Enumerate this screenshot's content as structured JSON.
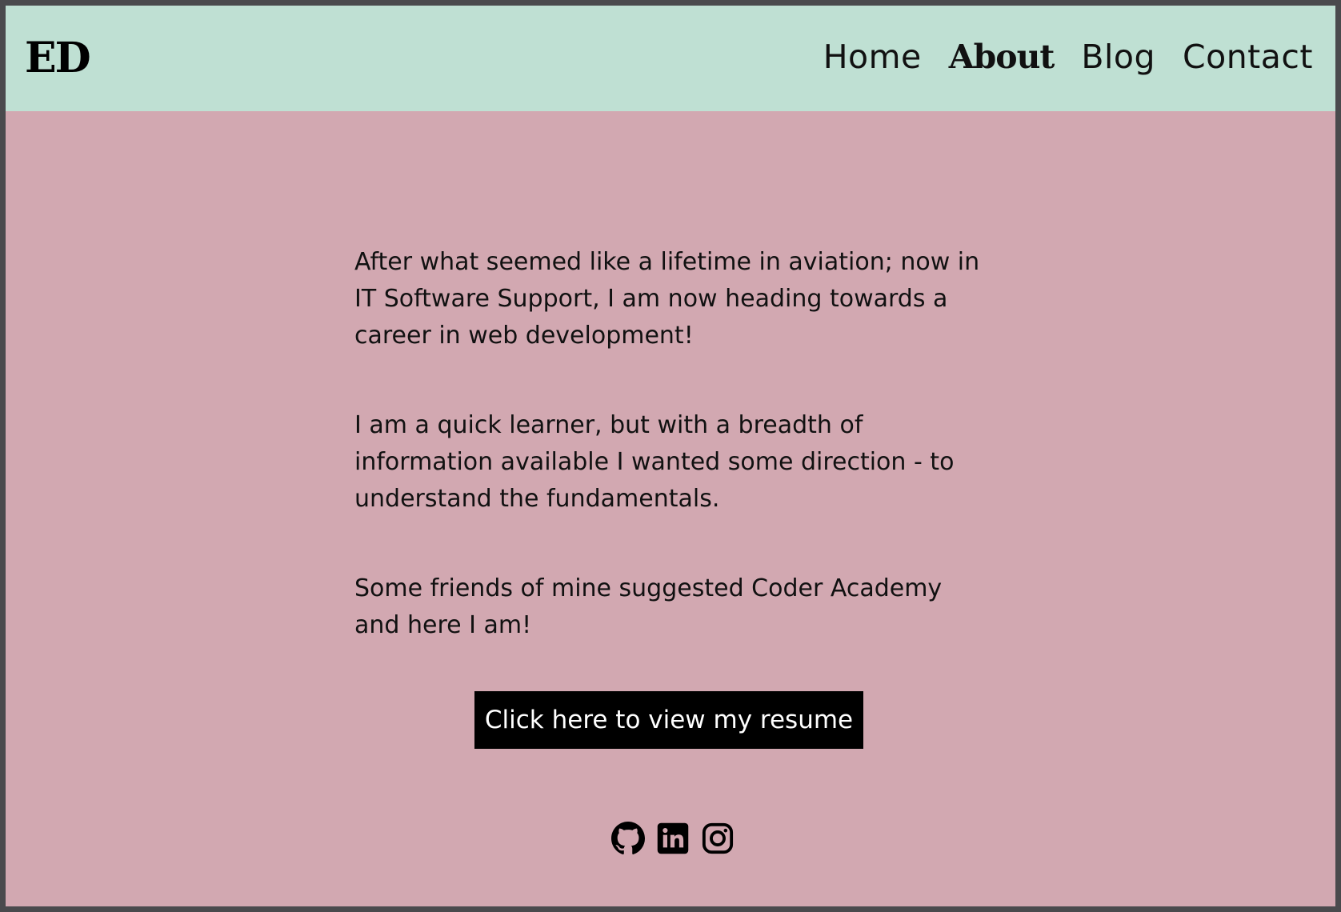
{
  "header": {
    "logo": "ED",
    "nav": [
      {
        "label": "Home",
        "active": false
      },
      {
        "label": "About",
        "active": true
      },
      {
        "label": "Blog",
        "active": false
      },
      {
        "label": "Contact",
        "active": false
      }
    ]
  },
  "main": {
    "paragraphs": [
      "After what seemed like a lifetime in aviation; now in IT Software Support, I am now heading towards a career in web development!",
      "I am a quick learner, but with a breadth of information available I wanted some direction - to understand the fundamentals.",
      "Some friends of mine suggested Coder Academy and here I am!"
    ],
    "resume_button": "Click here to view my resume"
  },
  "social": {
    "icons": [
      "github-icon",
      "linkedin-icon",
      "instagram-icon"
    ]
  },
  "colors": {
    "header_bg": "#bfe0d3",
    "page_bg": "#d2a8b1",
    "button_bg": "#000000",
    "button_text": "#ffffff"
  }
}
